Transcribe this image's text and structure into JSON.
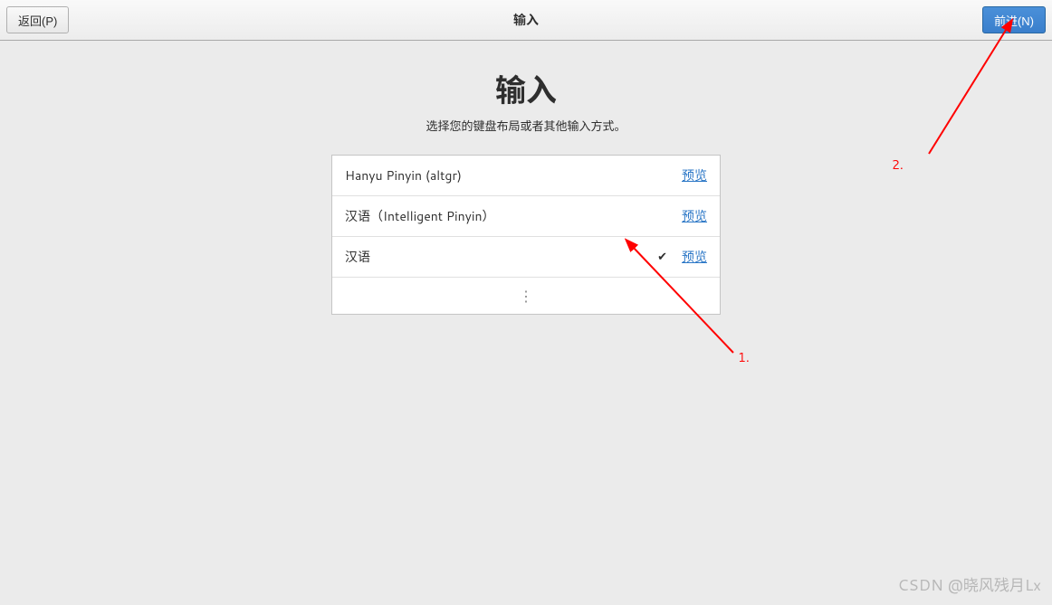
{
  "header": {
    "back_label": "返回(P)",
    "title": "输入",
    "next_label": "前进(N)"
  },
  "page": {
    "title": "输入",
    "subtitle": "选择您的键盘布局或者其他输入方式。"
  },
  "list": {
    "rows": [
      {
        "label": "Hanyu Pinyin (altgr)",
        "selected": false,
        "preview": "预览"
      },
      {
        "label": "汉语（Intelligent Pinyin）",
        "selected": false,
        "preview": "预览"
      },
      {
        "label": "汉语",
        "selected": true,
        "preview": "预览"
      }
    ]
  },
  "annotations": {
    "label1": "1.",
    "label2": "2."
  },
  "watermark": "CSDN @晓风残月Lx"
}
